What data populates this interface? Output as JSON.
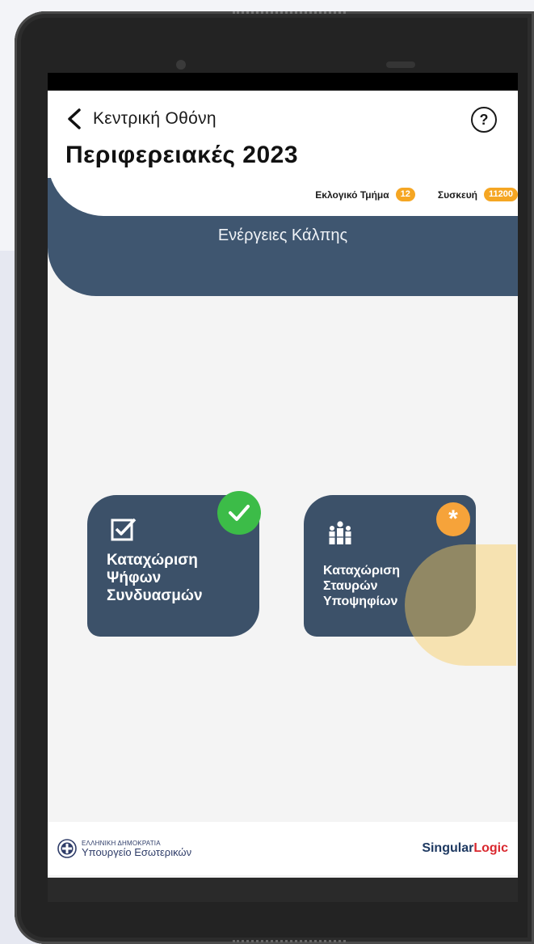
{
  "header": {
    "back_label": "Κεντρική Οθόνη",
    "title": "Περιφερειακές 2023",
    "help_icon": "question-circle-icon",
    "help_glyph": "?",
    "precinct_label": "Εκλογικό Τμήμα",
    "precinct_value": "12",
    "device_label": "Συσκευή",
    "device_value": "11200"
  },
  "section": {
    "title": "Ενέργειες Κάλπης"
  },
  "tiles": [
    {
      "label_lines": [
        "Καταχώριση",
        "Ψήφων",
        "Συνδυασμών"
      ],
      "icon": "checkbox-icon",
      "status": "completed",
      "status_color": "#3cbc48"
    },
    {
      "label_lines": [
        "Καταχώριση",
        "Σταυρών",
        "Υποψηφίων"
      ],
      "icon": "people-icon",
      "status": "pending",
      "status_glyph": "*",
      "status_color": "#f6a33a"
    }
  ],
  "footer": {
    "gov_line1": "ΕΛΛΗΝΙΚΗ ΔΗΜΟΚΡΑΤΙΑ",
    "gov_line2": "Υπουργείο Εσωτερικών",
    "brand_part1": "Singular",
    "brand_part2": "Logic"
  },
  "colors": {
    "primary": "#3f5670",
    "accent": "#f5a623",
    "success": "#3cbc48"
  }
}
